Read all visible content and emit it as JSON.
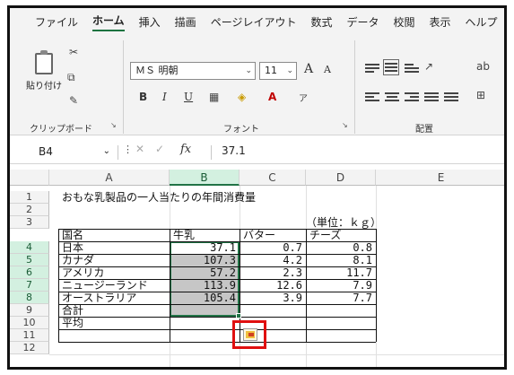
{
  "menu": [
    "ファイル",
    "ホーム",
    "挿入",
    "描画",
    "ページレイアウト",
    "数式",
    "データ",
    "校閲",
    "表示",
    "ヘルプ"
  ],
  "ribbon": {
    "paste_label": "貼り付け",
    "clipboard_label": "クリップボード",
    "font_name": "ＭＳ 明朝",
    "font_size": "11",
    "bold": "B",
    "italic": "I",
    "underline": "U",
    "font_group_label": "フォント",
    "align_group_label": "配置",
    "grow_font": "A",
    "shrink_font": "A"
  },
  "formula_bar": {
    "name_box": "B4",
    "fx": "fx",
    "value": "37.1"
  },
  "columns": [
    "A",
    "B",
    "C",
    "D",
    "E"
  ],
  "rows": [
    "1",
    "2",
    "3",
    "4",
    "5",
    "6",
    "7",
    "8",
    "9",
    "10",
    "11",
    "12"
  ],
  "sheet": {
    "title": "おもな乳製品の一人当たりの年間消費量",
    "unit": "（単位：ｋｇ）",
    "headers": [
      "国名",
      "牛乳",
      "バター",
      "チーズ"
    ],
    "data": [
      {
        "name": "日本",
        "milk": "37.1",
        "butter": "0.7",
        "cheese": "0.8"
      },
      {
        "name": "カナダ",
        "milk": "107.3",
        "butter": "4.2",
        "cheese": "8.1"
      },
      {
        "name": "アメリカ",
        "milk": "57.2",
        "butter": "2.3",
        "cheese": "11.7"
      },
      {
        "name": "ニュージーランド",
        "milk": "113.9",
        "butter": "12.6",
        "cheese": "7.9"
      },
      {
        "name": "オーストラリア",
        "milk": "105.4",
        "butter": "3.9",
        "cheese": "7.7"
      }
    ],
    "total_label": "合計",
    "avg_label": "平均"
  }
}
